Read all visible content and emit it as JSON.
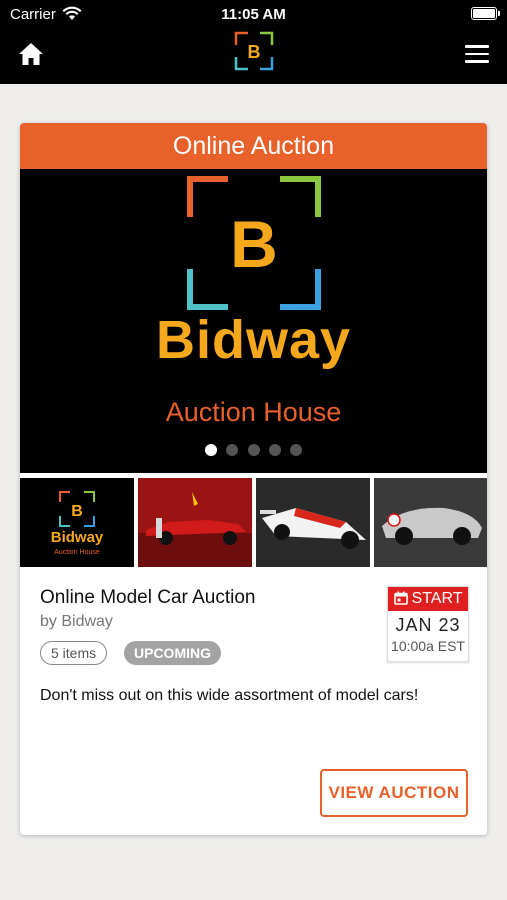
{
  "status_bar": {
    "carrier": "Carrier",
    "time": "11:05 AM"
  },
  "nav": {
    "home_icon": "home-icon",
    "logo_letter": "B",
    "menu_icon": "hamburger-menu-icon"
  },
  "card": {
    "header": "Online Auction",
    "hero": {
      "logo_letter": "B",
      "brand": "Bidway",
      "subtitle": "Auction House",
      "slides": 5,
      "active_slide": 1
    },
    "thumbnails": [
      {
        "label": "Bidway",
        "sublabel": "Auction House"
      },
      {
        "label": ""
      },
      {
        "label": ""
      },
      {
        "label": ""
      }
    ],
    "title": "Online Model Car Auction",
    "by": "by Bidway",
    "items_pill": "5 items",
    "status_pill": "UPCOMING",
    "date": {
      "label": "START",
      "day": "JAN 23",
      "time": "10:00a EST"
    },
    "description": "Don't miss out on this wide assortment of model cars!",
    "button": "VIEW AUCTION"
  },
  "colors": {
    "accent": "#e8602a",
    "brand_yellow": "#f6a81d",
    "start_red": "#e02020",
    "pill_gray": "#a3a3a3"
  }
}
